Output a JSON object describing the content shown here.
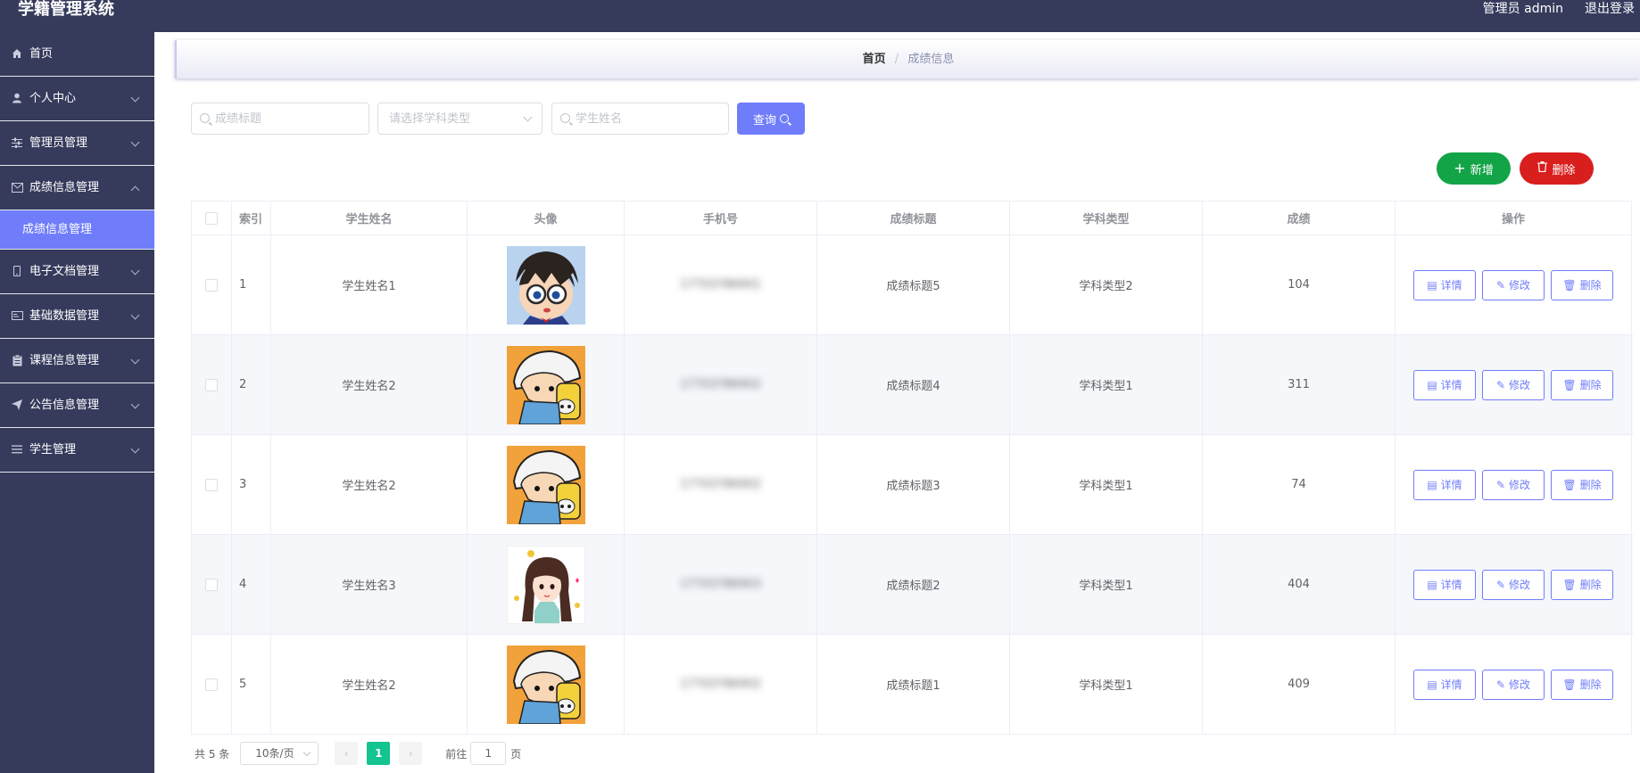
{
  "header": {
    "title": "学籍管理系统",
    "user": "管理员 admin",
    "logout": "退出登录"
  },
  "sidebar": {
    "items": [
      {
        "label": "首页",
        "icon": "home-icon"
      },
      {
        "label": "个人中心",
        "icon": "user-icon"
      },
      {
        "label": "管理员管理",
        "icon": "sliders-icon"
      },
      {
        "label": "成绩信息管理",
        "icon": "mail-icon",
        "expanded": true
      },
      {
        "label": "电子文档管理",
        "icon": "phone-icon"
      },
      {
        "label": "基础数据管理",
        "icon": "card-icon"
      },
      {
        "label": "课程信息管理",
        "icon": "clipboard-icon"
      },
      {
        "label": "公告信息管理",
        "icon": "send-icon"
      },
      {
        "label": "学生管理",
        "icon": "list-icon"
      }
    ],
    "active_sub": "成绩信息管理"
  },
  "breadcrumb": {
    "home": "首页",
    "sep": "/",
    "current": "成绩信息"
  },
  "search": {
    "title_placeholder": "成绩标题",
    "type_placeholder": "请选择学科类型",
    "name_placeholder": "学生姓名",
    "query_label": "查询"
  },
  "actions": {
    "add_label": "新增",
    "delete_label": "删除"
  },
  "table": {
    "headers": [
      "索引",
      "学生姓名",
      "头像",
      "手机号",
      "成绩标题",
      "学科类型",
      "成绩",
      "操作"
    ],
    "rows": [
      {
        "index": "1",
        "name": "学生姓名1",
        "avatar": "conan",
        "phone": "17703786901",
        "title": "成绩标题5",
        "type": "学科类型2",
        "score": "104"
      },
      {
        "index": "2",
        "name": "学生姓名2",
        "avatar": "shin",
        "phone": "17703786902",
        "title": "成绩标题4",
        "type": "学科类型1",
        "score": "311"
      },
      {
        "index": "3",
        "name": "学生姓名2",
        "avatar": "shin",
        "phone": "17703786902",
        "title": "成绩标题3",
        "type": "学科类型1",
        "score": "74"
      },
      {
        "index": "4",
        "name": "学生姓名3",
        "avatar": "girl",
        "phone": "17703786903",
        "title": "成绩标题2",
        "type": "学科类型1",
        "score": "404"
      },
      {
        "index": "5",
        "name": "学生姓名2",
        "avatar": "shin",
        "phone": "17703786902",
        "title": "成绩标题1",
        "type": "学科类型1",
        "score": "409"
      }
    ],
    "ops": {
      "detail": "详情",
      "edit": "修改",
      "delete": "删除"
    }
  },
  "pager": {
    "total": "共 5 条",
    "page_size": "10条/页",
    "current_page": "1",
    "goto_prefix": "前往",
    "goto_value": "1",
    "goto_suffix": "页"
  },
  "colors": {
    "sidebar_bg": "#363b5c",
    "accent": "#6f7dfa",
    "add_green": "#13a447",
    "delete_red": "#d91e1e",
    "page_active": "#13c490"
  }
}
